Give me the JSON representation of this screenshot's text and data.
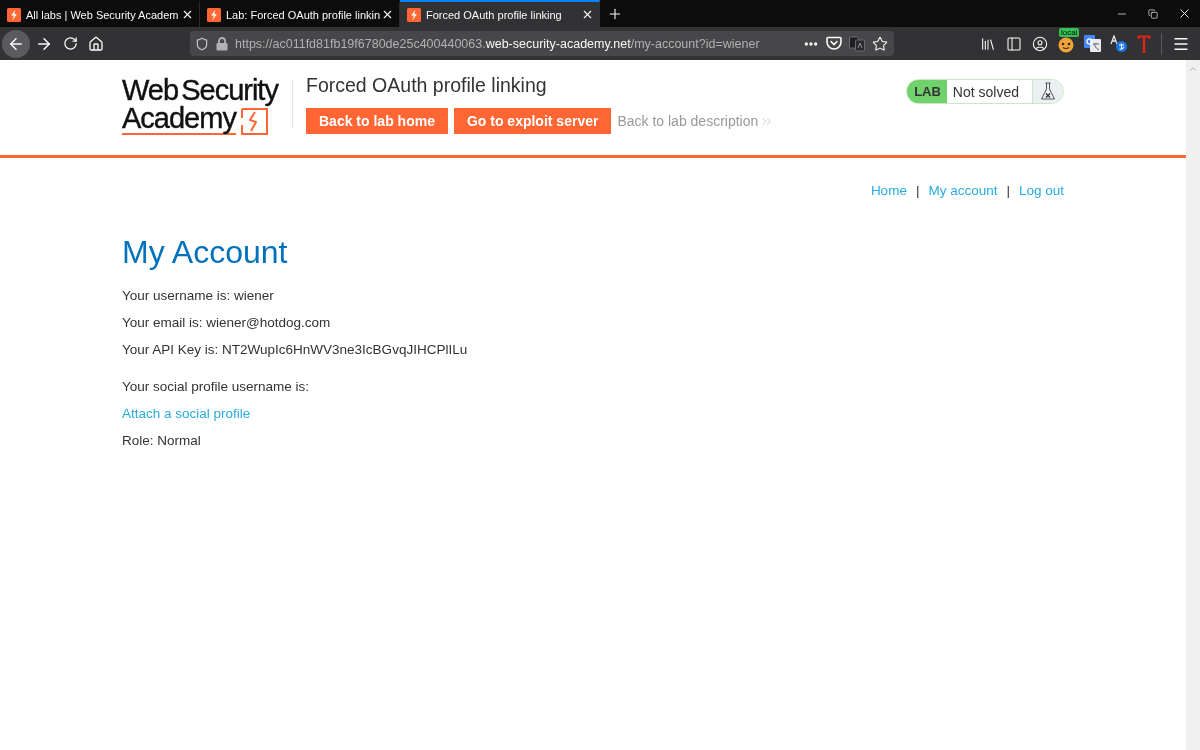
{
  "browser": {
    "tabs": [
      {
        "title": "All labs | Web Security Academ",
        "selected": false
      },
      {
        "title": "Lab: Forced OAuth profile linkin",
        "selected": false
      },
      {
        "title": "Forced OAuth profile linking",
        "selected": true
      }
    ],
    "address": {
      "origin_start": "https://ac011fd81fb19f6780de25c400440063.",
      "domain": "web-security-academy.net",
      "path": "/my-account?id=wiener"
    },
    "extension_badge": "local"
  },
  "lab_header": {
    "logo": [
      "Web Security",
      "Academy"
    ],
    "title": "Forced OAuth profile linking",
    "buttons": [
      "Back to lab home",
      "Go to exploit server"
    ],
    "description_link": "Back to lab description",
    "status": {
      "label": "LAB",
      "text": "Not solved",
      "solved": false
    }
  },
  "nav": [
    {
      "kind": "link",
      "text": "Home"
    },
    {
      "kind": "separator",
      "text": "|"
    },
    {
      "kind": "link",
      "text": "My account"
    },
    {
      "kind": "separator",
      "text": "|"
    },
    {
      "kind": "link",
      "text": "Log out"
    }
  ],
  "account": {
    "heading": "My Account",
    "details": [
      "Your username is: wiener",
      "Your email is: wiener@hotdog.com",
      "Your API Key is: NT2WupIc6HnWV3ne3IcBGvqJIHCPlILu"
    ],
    "social": [
      {
        "kind": "text",
        "text": "Your social profile username is:"
      },
      {
        "kind": "link",
        "text": "Attach a social profile"
      },
      {
        "kind": "text",
        "text": "Role: Normal"
      }
    ]
  }
}
